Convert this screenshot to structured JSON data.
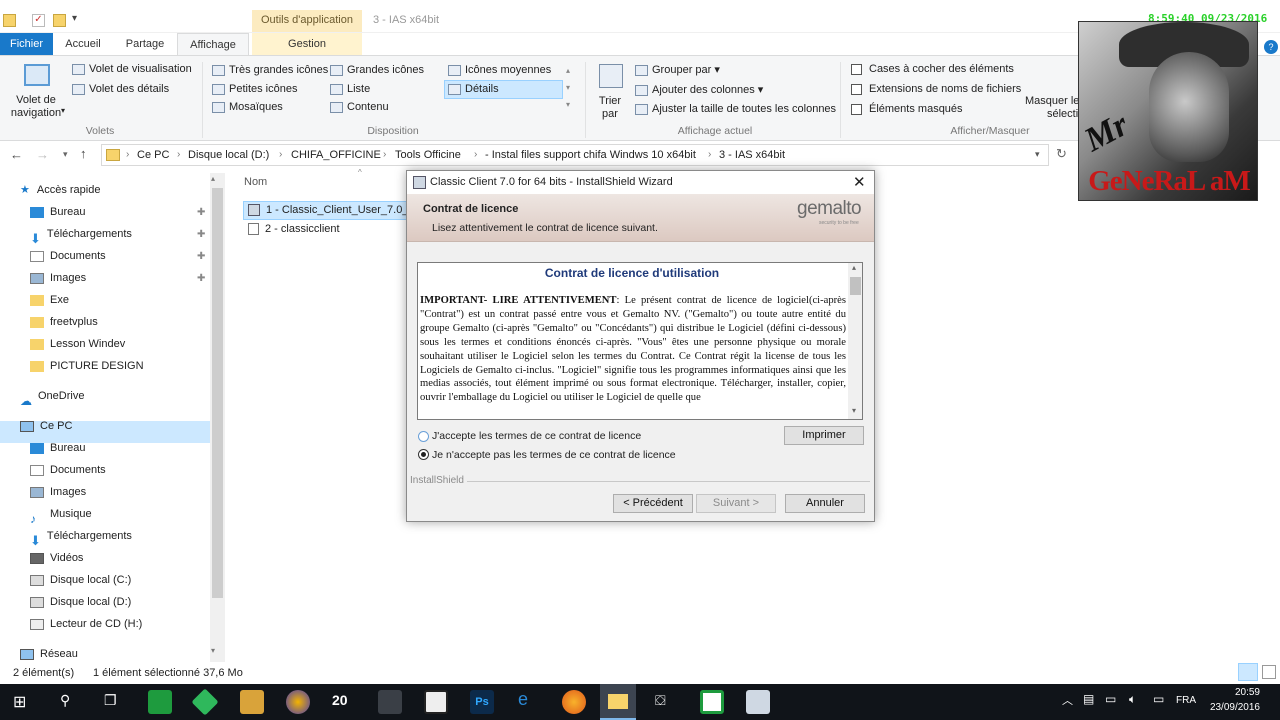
{
  "titlebar": {
    "context_tab": "Outils d'application",
    "window_title": "3 - IAS x64bit",
    "stamp": "8:59:40 09/23/2016"
  },
  "tabs": {
    "fichier": "Fichier",
    "accueil": "Accueil",
    "partage": "Partage",
    "affichage": "Affichage",
    "gestion": "Gestion"
  },
  "ribbon": {
    "nav_pane": "Volet de\nnavigation",
    "preview_pane": "Volet de visualisation",
    "details_pane": "Volet des détails",
    "group_volets": "Volets",
    "layout": {
      "very_large": "Très grandes icônes",
      "large": "Grandes icônes",
      "medium": "Icônes moyennes",
      "small": "Petites icônes",
      "list": "Liste",
      "details": "Détails",
      "tiles": "Mosaïques",
      "content": "Contenu"
    },
    "group_disposition": "Disposition",
    "sort_by": "Trier\npar",
    "group_by": "Grouper par",
    "add_columns": "Ajouter des colonnes",
    "fit_columns": "Ajuster la taille de toutes les colonnes",
    "group_affichage": "Affichage actuel",
    "checkboxes": "Cases à cocher des éléments",
    "extensions": "Extensions de noms de fichiers",
    "hidden": "Éléments masqués",
    "hide_selected": "Masquer le",
    "hide_selected2": "sélecti",
    "group_afficher": "Afficher/Masquer"
  },
  "address": {
    "crumbs": [
      "Ce PC",
      "Disque local (D:)",
      "CHIFA_OFFICINE",
      "Tools Officine",
      "- Instal files support chifa Windws 10 x64bit",
      "3 - IAS x64bit"
    ]
  },
  "nav": {
    "quick_access": "Accès rapide",
    "bureau": "Bureau",
    "telechargements": "Téléchargements",
    "documents": "Documents",
    "images": "Images",
    "exe": "Exe",
    "freetvplus": "freetvplus",
    "lesson": "Lesson Windev",
    "picture": "PICTURE DESIGN",
    "onedrive": "OneDrive",
    "cepc": "Ce PC",
    "bureau2": "Bureau",
    "documents2": "Documents",
    "images2": "Images",
    "musique": "Musique",
    "telechargements2": "Téléchargements",
    "videos": "Vidéos",
    "disque_c": "Disque local (C:)",
    "disque_d": "Disque local (D:)",
    "cd": "Lecteur de CD (H:)",
    "reseau": "Réseau"
  },
  "files": {
    "column_name": "Nom",
    "file1": "1 - Classic_Client_User_7.0_x64",
    "file2": "2 - classicclient"
  },
  "status": {
    "count": "2 élément(s)",
    "selected": "1 élément sélectionné 37,6 Mo"
  },
  "photo": {
    "mr": "Mr",
    "general": "GeNeRaL aM"
  },
  "dialog": {
    "title": "Classic Client 7.0 for 64 bits - InstallShield Wizard",
    "header_title": "Contrat de licence",
    "header_sub": "Lisez attentivement le contrat de licence suivant.",
    "brand": "gemalto",
    "brand_sub": "security to be free",
    "license_title": "Contrat de licence d'utilisation",
    "license_lead": "IMPORTANT- LIRE ATTENTIVEMENT",
    "license_text": ": Le présent contrat de licence de logiciel(ci-après \"Contrat\") est un contrat passé entre vous et Gemalto NV. (\"Gemalto\") ou toute autre entité du groupe Gemalto (ci-après \"Gemalto\" ou \"Concédants\") qui distribue le Logiciel (défini ci-dessous) sous les termes et conditions énoncés ci-après. \"Vous\" êtes une personne physique ou morale souhaitant utiliser le Logiciel selon les termes du Contrat. Ce Contrat régit la license de tous les Logiciels de Gemalto ci-inclus. \"Logiciel\" signifie tous les programmes informatiques ainsi que les medias associés, tout élément imprimé ou sous format electronique. Télécharger, installer, copier, ouvrir l'emballage du Logiciel ou utiliser le Logiciel de quelle que",
    "accept": "J'accepte les termes de ce contrat de licence",
    "decline": "Je n'accepte pas les termes de ce contrat de licence",
    "print": "Imprimer",
    "installshield": "InstallShield",
    "back": "< Précédent",
    "next": "Suivant >",
    "cancel": "Annuler"
  },
  "taskbar": {
    "app_20": "20",
    "lang": "FRA",
    "time": "20:59",
    "date": "23/09/2016"
  }
}
